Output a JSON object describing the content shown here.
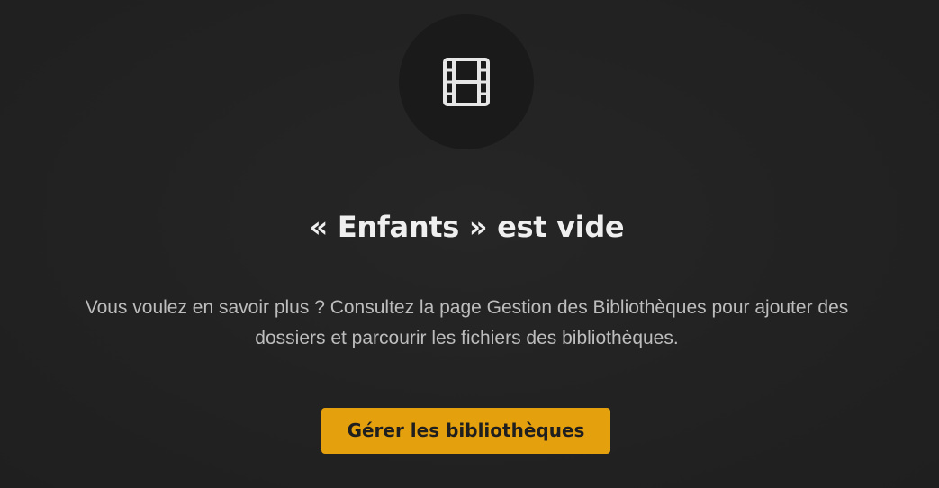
{
  "empty_state": {
    "icon": "film-icon",
    "title": "« Enfants » est vide",
    "description": "Vous voulez en savoir plus ? Consultez la page Gestion des Bibliothèques pour ajouter des dossiers et parcourir les fichiers des bibliothèques.",
    "button_label": "Gérer les bibliothèques"
  },
  "colors": {
    "background": "#222222",
    "icon_circle": "#1a1a1a",
    "icon": "#e6e6e6",
    "title": "#efefef",
    "description": "#bdbdbd",
    "accent": "#e5a00d",
    "button_text": "#1f1f1f"
  }
}
